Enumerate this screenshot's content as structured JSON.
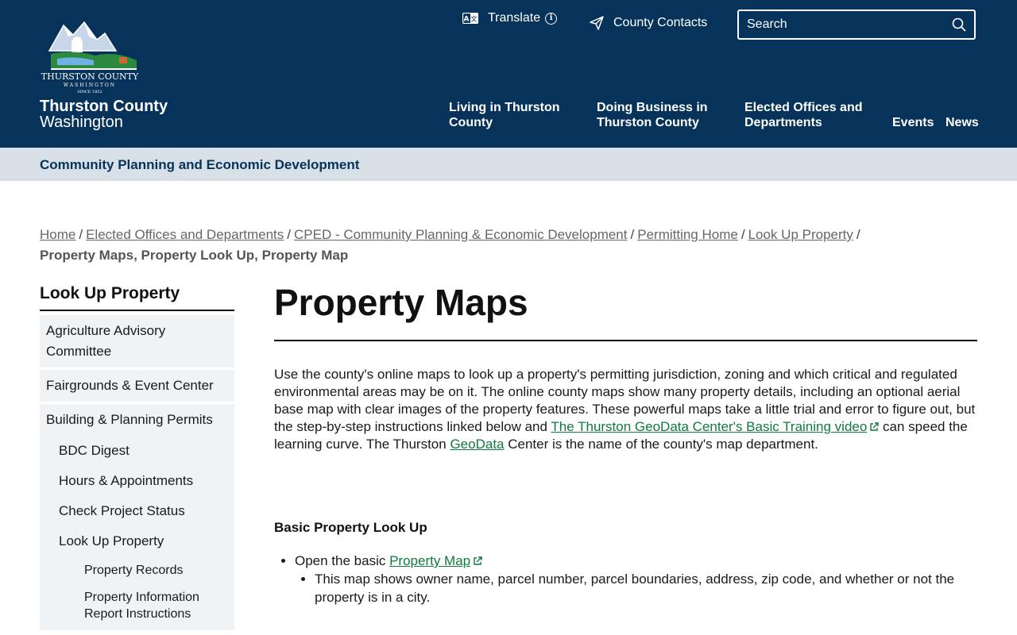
{
  "header": {
    "logo_alt": "Thurston County Washington seal",
    "logo_text": "THURSTON COUNTY",
    "logo_subtext": "WASHINGTON",
    "logo_since": "SINCE 1852",
    "site_name": "Thurston County",
    "site_sub": "Washington",
    "translate_label": "Translate",
    "contacts_label": "County Contacts",
    "search_placeholder": "Search",
    "nav": [
      {
        "label": "Living in Thurston County"
      },
      {
        "label": "Doing Business in Thurston County"
      },
      {
        "label": "Elected Offices and Departments"
      },
      {
        "label": "Events"
      },
      {
        "label": "News"
      }
    ],
    "bg_color": "#07335a"
  },
  "dept_bar": {
    "title": "Community Planning and Economic Development",
    "bg_color": "#d8e0e7"
  },
  "breadcrumb": {
    "links": [
      "Home",
      "Elected Offices and Departments",
      "CPED - Community Planning & Economic Development",
      "Permitting Home",
      "Look Up Property"
    ],
    "separator": "/",
    "current": "Property Maps, Property Look Up, Property Map"
  },
  "sidebar": {
    "title": "Look Up Property",
    "items": [
      {
        "label": "Agriculture Advisory Committee",
        "level": 1
      },
      {
        "label": "Fairgrounds & Event Center",
        "level": 1
      },
      {
        "label": "Building & Planning Permits",
        "level": 1
      },
      {
        "label": "BDC Digest",
        "level": 2
      },
      {
        "label": "Hours & Appointments",
        "level": 2
      },
      {
        "label": "Check Project Status",
        "level": 2
      },
      {
        "label": "Look Up Property",
        "level": 2
      },
      {
        "label": "Property Records",
        "level": 3
      },
      {
        "label": "Property Information Report Instructions",
        "level": 3
      }
    ]
  },
  "main": {
    "title": "Property Maps",
    "intro_1": "Use the county's online maps to look up a property's permitting jurisdiction, zoning and which critical and regulated environmental areas may be on it. The online county maps show many property details, including an optional aerial base map with clear images of the property features. These powerful maps take a little trial and error to figure out, but the step-by-step instructions linked below and ",
    "intro_link_1": "The Thurston GeoData Center's Basic Training video",
    "intro_2": " can speed the learning curve. The Thurston ",
    "intro_link_2": "GeoData",
    "intro_3": " Center is the name of the county's map department.",
    "section_heading": "Basic Property Look Up",
    "bullet_1_prefix": "Open the basic ",
    "bullet_1_link": "Property Map",
    "bullet_1_sub": "This map shows owner name, parcel number, parcel boundaries, address, zip code, and whether or not the property is in a city.",
    "link_color": "#0f7a3d"
  }
}
